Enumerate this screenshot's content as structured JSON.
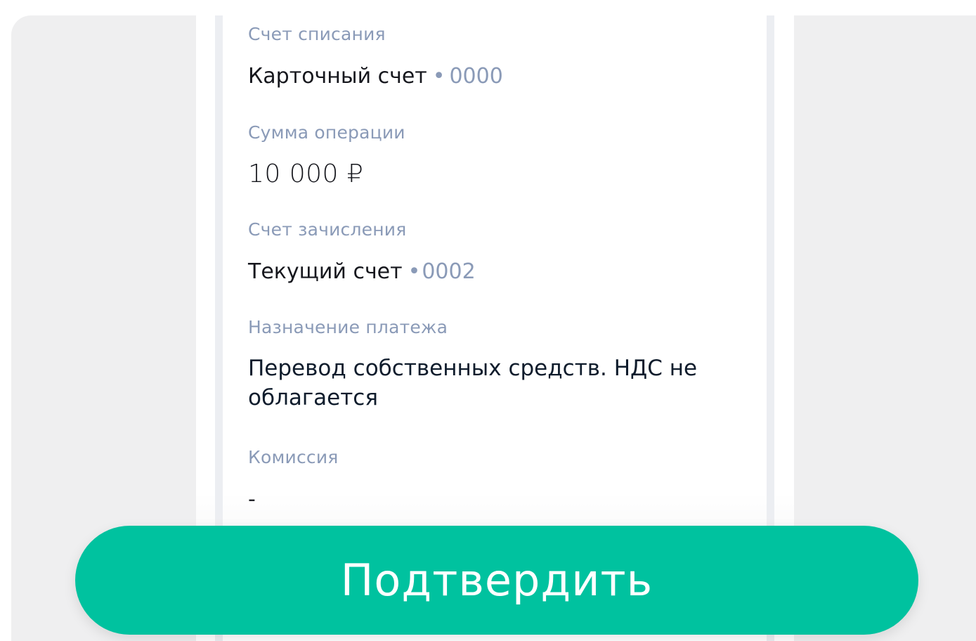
{
  "details": {
    "debit_account": {
      "label": "Счет списания",
      "name": "Карточный счет",
      "separator": "•",
      "number": "0000"
    },
    "amount": {
      "label": "Сумма операции",
      "value": "10 000 ₽"
    },
    "credit_account": {
      "label": "Счет зачисления",
      "name": "Текущий счет",
      "separator": "•",
      "number": "0002"
    },
    "purpose": {
      "label": "Назначение платежа",
      "value": "Перевод собственных средств. НДС не облагается"
    },
    "commission": {
      "label": "Комиссия",
      "value": "-"
    }
  },
  "actions": {
    "confirm_label": "Подтвердить"
  },
  "colors": {
    "accent": "#00c29f",
    "label_text": "#8a9ab7",
    "value_text": "#16171d",
    "background": "#efeff0"
  }
}
